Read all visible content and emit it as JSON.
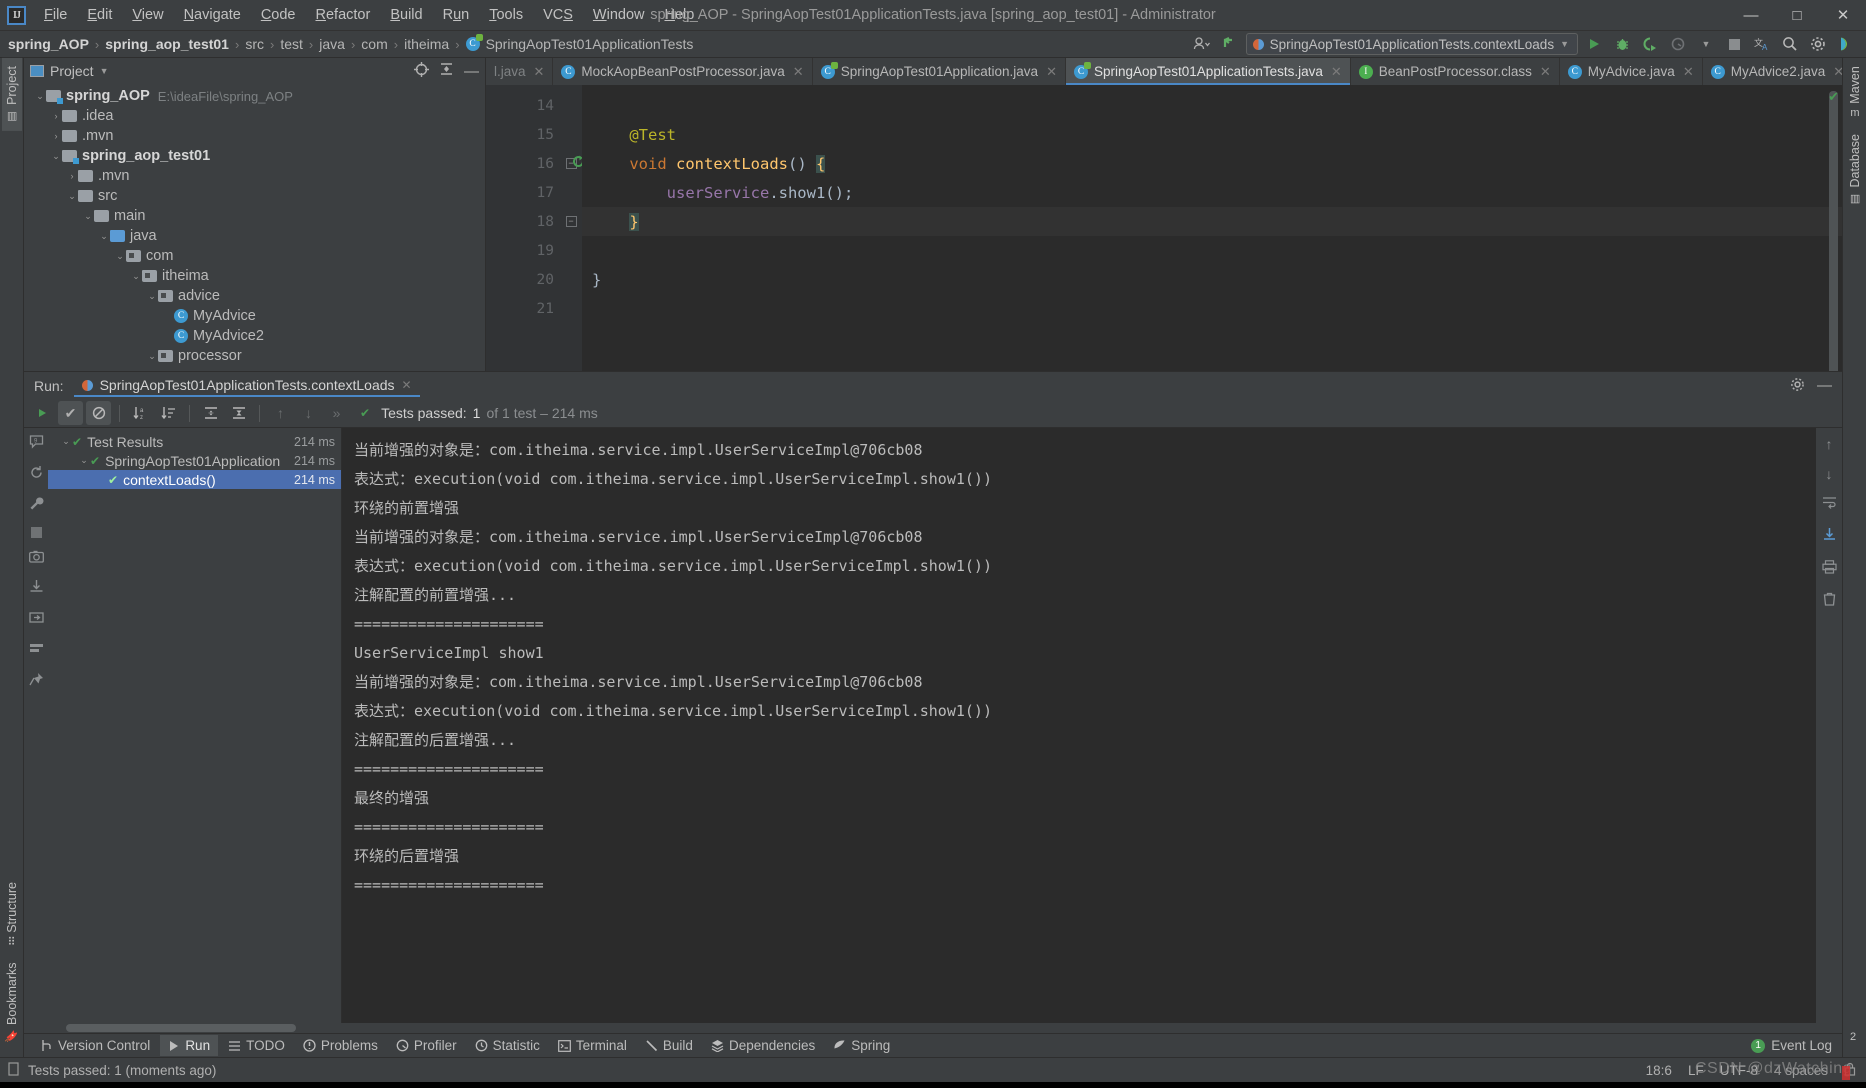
{
  "window": {
    "title": "spring_AOP - SpringAopTest01ApplicationTests.java [spring_aop_test01] - Administrator",
    "minimize": "—",
    "maximize": "□",
    "close": "✕"
  },
  "menu": {
    "items": [
      "File",
      "Edit",
      "View",
      "Navigate",
      "Code",
      "Refactor",
      "Build",
      "Run",
      "Tools",
      "VCS",
      "Window",
      "Help"
    ]
  },
  "navbar": {
    "crumbs": [
      "spring_AOP",
      "spring_aop_test01",
      "src",
      "test",
      "java",
      "com",
      "itheima",
      "SpringAopTest01ApplicationTests"
    ],
    "separator": "›",
    "run_config": "SpringAopTest01ApplicationTests.contextLoads",
    "dropdown_caret": "▼"
  },
  "project_panel": {
    "title": "Project",
    "caret": "▼",
    "tree": [
      {
        "depth": 0,
        "twisty": "⌄",
        "icon": "module",
        "label": "spring_AOP",
        "bold": true,
        "path": "E:\\ideaFile\\spring_AOP"
      },
      {
        "depth": 1,
        "twisty": "›",
        "icon": "folder",
        "label": ".idea",
        "bold": false,
        "path": ""
      },
      {
        "depth": 1,
        "twisty": "›",
        "icon": "folder",
        "label": ".mvn",
        "bold": false,
        "path": ""
      },
      {
        "depth": 1,
        "twisty": "⌄",
        "icon": "module",
        "label": "spring_aop_test01",
        "bold": true,
        "path": ""
      },
      {
        "depth": 2,
        "twisty": "›",
        "icon": "folder",
        "label": ".mvn",
        "bold": false,
        "path": ""
      },
      {
        "depth": 2,
        "twisty": "⌄",
        "icon": "folder",
        "label": "src",
        "bold": false,
        "path": ""
      },
      {
        "depth": 3,
        "twisty": "⌄",
        "icon": "folder",
        "label": "main",
        "bold": false,
        "path": ""
      },
      {
        "depth": 4,
        "twisty": "⌄",
        "icon": "folder-blue",
        "label": "java",
        "bold": false,
        "path": ""
      },
      {
        "depth": 5,
        "twisty": "⌄",
        "icon": "package",
        "label": "com",
        "bold": false,
        "path": ""
      },
      {
        "depth": 6,
        "twisty": "⌄",
        "icon": "package",
        "label": "itheima",
        "bold": false,
        "path": ""
      },
      {
        "depth": 7,
        "twisty": "⌄",
        "icon": "package",
        "label": "advice",
        "bold": false,
        "path": ""
      },
      {
        "depth": 8,
        "twisty": "",
        "icon": "class",
        "label": "MyAdvice",
        "bold": false,
        "path": ""
      },
      {
        "depth": 8,
        "twisty": "",
        "icon": "class",
        "label": "MyAdvice2",
        "bold": false,
        "path": ""
      },
      {
        "depth": 7,
        "twisty": "⌄",
        "icon": "package",
        "label": "processor",
        "bold": false,
        "path": ""
      }
    ]
  },
  "editor": {
    "tabs": [
      {
        "label": "l.java",
        "icon": "class",
        "truncated": true,
        "active": false
      },
      {
        "label": "MockAopBeanPostProcessor.java",
        "icon": "class",
        "active": false
      },
      {
        "label": "SpringAopTest01Application.java",
        "icon": "spring",
        "active": false
      },
      {
        "label": "SpringAopTest01ApplicationTests.java",
        "icon": "spring",
        "active": true
      },
      {
        "label": "BeanPostProcessor.class",
        "icon": "interface",
        "active": false
      },
      {
        "label": "MyAdvice.java",
        "icon": "class",
        "active": false
      },
      {
        "label": "MyAdvice2.java",
        "icon": "class",
        "active": false
      }
    ],
    "close_glyph": "✕",
    "lines": [
      {
        "num": "14",
        "tokens": [],
        "fold": "",
        "run": false,
        "highlight": false
      },
      {
        "num": "15",
        "tokens": [
          {
            "t": "    ",
            "c": "def"
          },
          {
            "t": "@Test",
            "c": "ann"
          }
        ],
        "fold": "",
        "run": false,
        "highlight": false
      },
      {
        "num": "16",
        "tokens": [
          {
            "t": "    ",
            "c": "def"
          },
          {
            "t": "void",
            "c": "kw"
          },
          {
            "t": " ",
            "c": "def"
          },
          {
            "t": "contextLoads",
            "c": "m"
          },
          {
            "t": "() ",
            "c": "def"
          },
          {
            "t": "{",
            "c": "brace"
          }
        ],
        "fold": "−",
        "run": true,
        "highlight": false
      },
      {
        "num": "17",
        "tokens": [
          {
            "t": "        ",
            "c": "def"
          },
          {
            "t": "userService",
            "c": "fld"
          },
          {
            "t": ".show1();",
            "c": "def"
          }
        ],
        "fold": "",
        "run": false,
        "highlight": false
      },
      {
        "num": "18",
        "tokens": [
          {
            "t": "    ",
            "c": "def"
          },
          {
            "t": "}",
            "c": "brace"
          }
        ],
        "fold": "−",
        "run": false,
        "highlight": true
      },
      {
        "num": "19",
        "tokens": [],
        "fold": "",
        "run": false,
        "highlight": false
      },
      {
        "num": "20",
        "tokens": [
          {
            "t": "}",
            "c": "def"
          }
        ],
        "fold": "",
        "run": false,
        "highlight": false
      },
      {
        "num": "21",
        "tokens": [],
        "fold": "",
        "run": false,
        "highlight": false
      }
    ]
  },
  "run_panel": {
    "label": "Run:",
    "tab_title": "SpringAopTest01ApplicationTests.contextLoads",
    "close_glyph": "✕",
    "status_prefix": "Tests passed:",
    "status_count": "1",
    "status_suffix": "of 1 test – 214 ms",
    "overflow_glyph": "»",
    "tree": [
      {
        "depth": 0,
        "twisty": "⌄",
        "label": "Test Results",
        "time": "214 ms",
        "selected": false
      },
      {
        "depth": 1,
        "twisty": "⌄",
        "label": "SpringAopTest01Application",
        "time": "214 ms",
        "selected": false
      },
      {
        "depth": 2,
        "twisty": "",
        "label": "contextLoads()",
        "time": "214 ms",
        "selected": true
      }
    ],
    "console": [
      "当前增强的对象是：com.itheima.service.impl.UserServiceImpl@706cb08",
      "表达式：execution(void com.itheima.service.impl.UserServiceImpl.show1())",
      "环绕的前置增强",
      "当前增强的对象是：com.itheima.service.impl.UserServiceImpl@706cb08",
      "表达式：execution(void com.itheima.service.impl.UserServiceImpl.show1())",
      "注解配置的前置增强...",
      "=====================",
      "UserServiceImpl show1",
      "当前增强的对象是：com.itheima.service.impl.UserServiceImpl@706cb08",
      "表达式：execution(void com.itheima.service.impl.UserServiceImpl.show1())",
      "注解配置的后置增强...",
      "=====================",
      "最终的增强",
      "=====================",
      "环绕的后置增强",
      "====================="
    ]
  },
  "tool_strips": {
    "left_top": [
      "Project"
    ],
    "left_bottom": [
      "Structure",
      "Bookmarks"
    ],
    "right": [
      "Maven",
      "Database",
      "Notifications"
    ]
  },
  "bottom_bar": {
    "items": [
      {
        "label": "Version Control",
        "icon": "branch-icon",
        "active": false
      },
      {
        "label": "Run",
        "icon": "play-icon",
        "active": true
      },
      {
        "label": "TODO",
        "icon": "list-icon",
        "active": false
      },
      {
        "label": "Problems",
        "icon": "error-icon",
        "active": false
      },
      {
        "label": "Profiler",
        "icon": "gauge-icon",
        "active": false
      },
      {
        "label": "Statistic",
        "icon": "clock-icon",
        "active": false
      },
      {
        "label": "Terminal",
        "icon": "terminal-icon",
        "active": false
      },
      {
        "label": "Build",
        "icon": "hammer-icon",
        "active": false
      },
      {
        "label": "Dependencies",
        "icon": "layers-icon",
        "active": false
      },
      {
        "label": "Spring",
        "icon": "leaf-icon",
        "active": false
      }
    ],
    "event_log": "Event Log",
    "event_count": "1"
  },
  "status_bar": {
    "message": "Tests passed: 1 (moments ago)",
    "caret": "18:6",
    "line_sep": "LF",
    "encoding": "UTF-8",
    "indent": "4 spaces",
    "watermark": "CSDN @dzWatching"
  },
  "colors": {
    "accent": "#4a88c7",
    "success": "#499c54",
    "selection": "#4b6eaf",
    "panel_bg": "#3c3f41",
    "editor_bg": "#2b2b2b",
    "spring_green": "#6db33f"
  }
}
